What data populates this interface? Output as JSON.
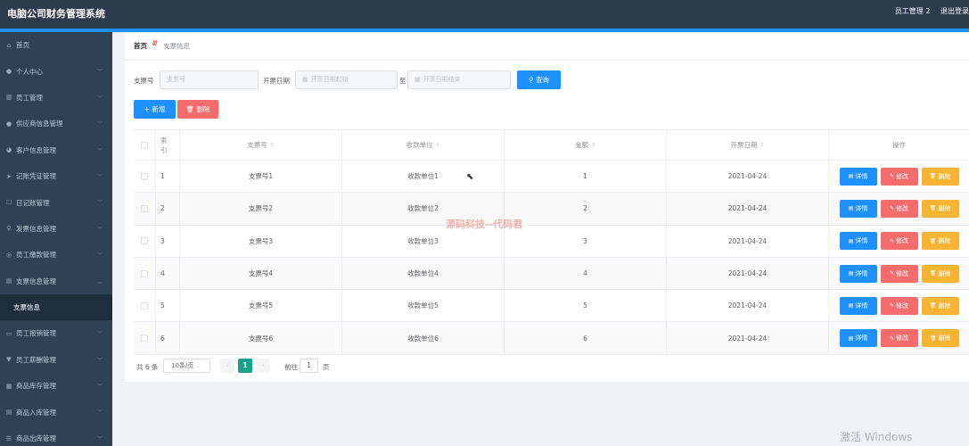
{
  "app": {
    "title": "电脑公司财务管理系统",
    "nav_user": "员工管理 2",
    "nav_logout": "退出登录"
  },
  "sidebar": {
    "items": [
      {
        "icon": "home-icon",
        "glyph": "⌂",
        "label": "首页",
        "arrow": false
      },
      {
        "icon": "user-icon",
        "glyph": "●",
        "label": "个人中心",
        "arrow": true
      },
      {
        "icon": "chart-icon",
        "glyph": "▥",
        "label": "员工管理",
        "arrow": true
      },
      {
        "icon": "person-icon",
        "glyph": "●",
        "label": "供应商信息管理",
        "arrow": true
      },
      {
        "icon": "chat-icon",
        "glyph": "◕",
        "label": "客户信息管理",
        "arrow": true
      },
      {
        "icon": "send-icon",
        "glyph": "➤",
        "label": "记账凭证管理",
        "arrow": true
      },
      {
        "icon": "note-icon",
        "glyph": "☐",
        "label": "日记账管理",
        "arrow": true
      },
      {
        "icon": "mic-icon",
        "glyph": "♀",
        "label": "发票信息管理",
        "arrow": true
      },
      {
        "icon": "globe-icon",
        "glyph": "◎",
        "label": "员工缴款管理",
        "arrow": true
      },
      {
        "icon": "doc-icon",
        "glyph": "▤",
        "label": "支票信息管理",
        "arrow": true,
        "open": true
      },
      {
        "icon": "",
        "glyph": "",
        "label": "支票信息",
        "arrow": false,
        "sub": true
      },
      {
        "icon": "card-icon",
        "glyph": "▭",
        "label": "员工报销管理",
        "arrow": true
      },
      {
        "icon": "stamp-icon",
        "glyph": "▼",
        "label": "员工薪酬管理",
        "arrow": true
      },
      {
        "icon": "box-icon",
        "glyph": "▦",
        "label": "商品库存管理",
        "arrow": true
      },
      {
        "icon": "inbox-icon",
        "glyph": "▤",
        "label": "商品入库管理",
        "arrow": true
      },
      {
        "icon": "outbox-icon",
        "glyph": "☰",
        "label": "商品出库管理",
        "arrow": true
      }
    ]
  },
  "breadcrumb": {
    "home": "首页",
    "current": "支票信息"
  },
  "search": {
    "check_no_label": "支票号",
    "check_no_placeholder": "支票号",
    "date_label": "开票日期",
    "date_start_placeholder": "开票日期起始",
    "to_label": "至",
    "date_end_placeholder": "开票日期结束",
    "query_button": "查询"
  },
  "actions": {
    "add": "新增",
    "delete": "删除"
  },
  "table": {
    "headers": {
      "index": "索引",
      "check_no": "支票号",
      "unit": "收款单位",
      "amount": "金额",
      "date": "开票日期",
      "ops": "操作"
    },
    "row_buttons": {
      "detail": "详情",
      "edit": "修改",
      "delete": "删除"
    },
    "rows": [
      {
        "index": "1",
        "check_no": "支票号1",
        "unit": "收款单位1",
        "amount": "1",
        "date": "2021-04-24"
      },
      {
        "index": "2",
        "check_no": "支票号2",
        "unit": "收款单位2",
        "amount": "2",
        "date": "2021-04-24"
      },
      {
        "index": "3",
        "check_no": "支票号3",
        "unit": "收款单位3",
        "amount": "3",
        "date": "2021-04-24"
      },
      {
        "index": "4",
        "check_no": "支票号4",
        "unit": "收款单位4",
        "amount": "4",
        "date": "2021-04-24"
      },
      {
        "index": "5",
        "check_no": "支票号5",
        "unit": "收款单位5",
        "amount": "5",
        "date": "2021-04-24"
      },
      {
        "index": "6",
        "check_no": "支票号6",
        "unit": "收款单位6",
        "amount": "6",
        "date": "2021-04-24"
      }
    ]
  },
  "pager": {
    "total": "共 6 条",
    "page_size": "10条/页",
    "current_page": "1",
    "goto_label": "前往",
    "goto_value": "1",
    "page_suffix": "页"
  },
  "watermark": "源码科技--代码君",
  "os_notice": "激活 Windows",
  "colors": {
    "header_bg": "#2d3a4b",
    "sidebar_bg": "#304156",
    "primary": "#1e90ff",
    "danger": "#f56c6c",
    "warning": "#f5b431",
    "pager_active": "#19a28b"
  }
}
